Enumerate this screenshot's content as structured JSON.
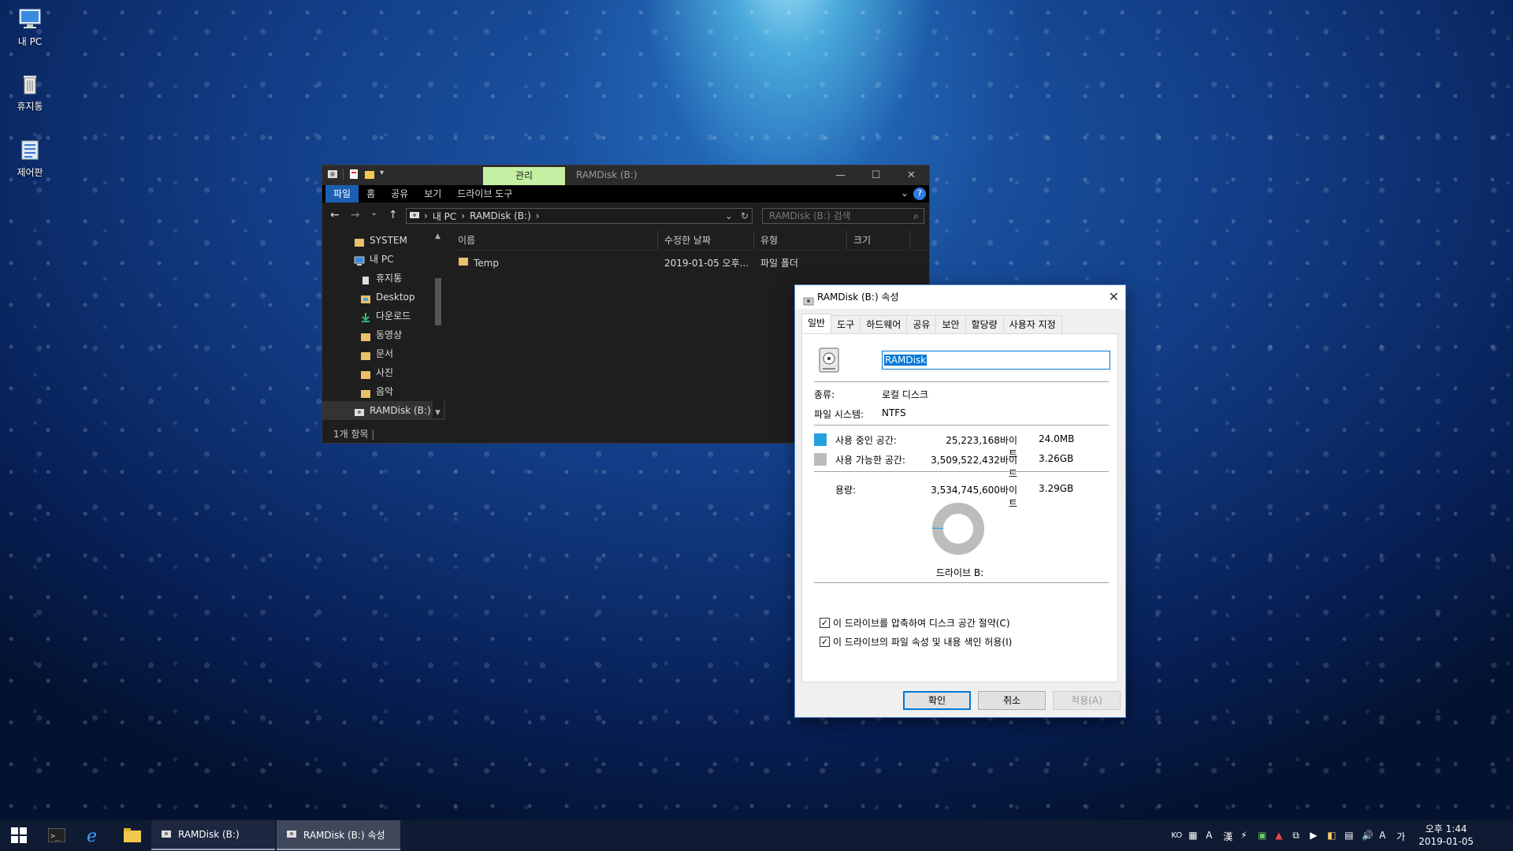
{
  "desktop": {
    "icons": [
      {
        "label": "내 PC"
      },
      {
        "label": "휴지통"
      },
      {
        "label": "제어판"
      }
    ]
  },
  "explorer": {
    "manage_tab": "관리",
    "title": "RAMDisk (B:)",
    "ribbon_tabs": [
      "파일",
      "홈",
      "공유",
      "보기",
      "드라이브 도구"
    ],
    "address": {
      "segments": [
        "내 PC",
        "RAMDisk (B:)"
      ]
    },
    "search_placeholder": "RAMDisk (B:) 검색",
    "nav_items": [
      "SYSTEM",
      "내 PC",
      "휴지통",
      "Desktop",
      "다운로드",
      "동영상",
      "문서",
      "사진",
      "음악",
      "RAMDisk (B:)"
    ],
    "columns": [
      "이름",
      "수정한 날짜",
      "유형",
      "크기"
    ],
    "rows": [
      {
        "name": "Temp",
        "modified": "2019-01-05 오후...",
        "type": "파일 폴더",
        "size": ""
      }
    ],
    "status": "1개 항목"
  },
  "dialog": {
    "title": "RAMDisk (B:) 속성",
    "tabs": [
      "일반",
      "도구",
      "하드웨어",
      "공유",
      "보안",
      "할당량",
      "사용자 지정"
    ],
    "volume_name": "RAMDisk",
    "type_label": "종류:",
    "type_value": "로컬 디스크",
    "fs_label": "파일 시스템:",
    "fs_value": "NTFS",
    "used_label": "사용 중인 공간:",
    "used_bytes": "25,223,168바이트",
    "used_short": "24.0MB",
    "free_label": "사용 가능한 공간:",
    "free_bytes": "3,509,522,432바이트",
    "free_short": "3.26GB",
    "capacity_label": "용량:",
    "capacity_bytes": "3,534,745,600바이트",
    "capacity_short": "3.29GB",
    "used_fraction": 0.0071,
    "drive_label": "드라이브 B:",
    "check_compress": "이 드라이브를 압축하여 디스크 공간 절약(C)",
    "check_index": "이 드라이브의 파일 속성 및 내용 색인 허용(I)",
    "ok": "확인",
    "cancel": "취소",
    "apply": "적용(A)",
    "colors": {
      "used": "#26a0da",
      "free": "#bcbcbc"
    }
  },
  "taskbar": {
    "apps": [
      "RAMDisk (B:)",
      "RAMDisk (B:) 속성"
    ],
    "lang": "KO",
    "time": "오후 1:44",
    "date": "2019-01-05"
  }
}
